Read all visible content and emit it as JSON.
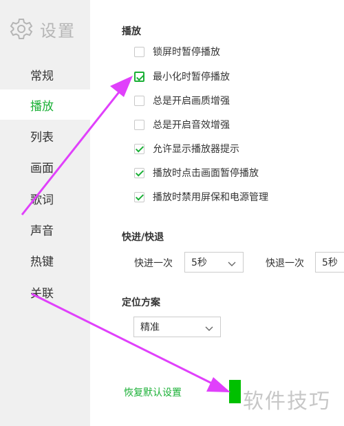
{
  "sidebar": {
    "title": "设置",
    "settings_icon": "gear-icon",
    "items": [
      {
        "label": "常规"
      },
      {
        "label": "播放",
        "active": true
      },
      {
        "label": "列表"
      },
      {
        "label": "画面"
      },
      {
        "label": "歌词"
      },
      {
        "label": "声音"
      },
      {
        "label": "热键"
      },
      {
        "label": "关联"
      }
    ]
  },
  "playback": {
    "title": "播放",
    "options": [
      {
        "label": "锁屏时暂停播放",
        "checked": false
      },
      {
        "label": "最小化时暂停播放",
        "checked": true
      },
      {
        "label": "总是开启画质增强",
        "checked": false
      },
      {
        "label": "总是开启音效增强",
        "checked": false
      },
      {
        "label": "允许显示播放器提示",
        "checked": true
      },
      {
        "label": "播放时点击画面暂停播放",
        "checked": true
      },
      {
        "label": "播放时禁用屏保和电源管理",
        "checked": true
      }
    ]
  },
  "seek": {
    "title": "快进/快退",
    "forward_label": "快进一次",
    "forward_value": "5秒",
    "backward_label": "快退一次",
    "backward_value": "5秒"
  },
  "positioning": {
    "title": "定位方案",
    "value": "精准"
  },
  "footer": {
    "reset_label": "恢复默认设置",
    "watermark": "软件技巧"
  },
  "colors": {
    "accent": "#1ab036",
    "annotation_arrow": "#e040fb",
    "sidebar_bg": "#f0f0f0"
  }
}
